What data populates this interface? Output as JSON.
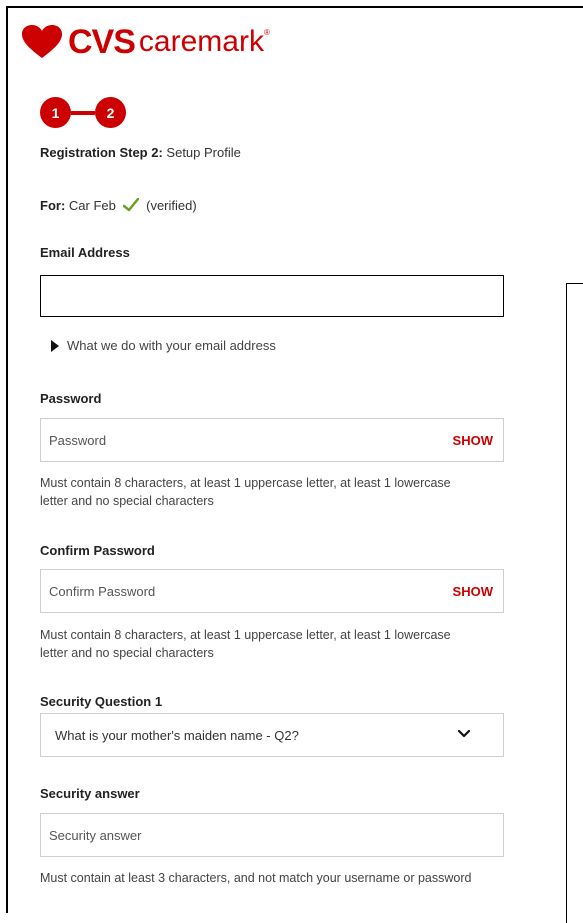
{
  "brand": {
    "primary": "CVS",
    "secondary": "caremark",
    "registered": "®",
    "color": "#cc0000"
  },
  "stepper": {
    "step1": "1",
    "step2": "2"
  },
  "registration": {
    "prefix": "Registration Step 2:",
    "text": "Setup Profile"
  },
  "for": {
    "label": "For:",
    "name": "Car Feb",
    "status": "(verified)"
  },
  "email": {
    "label": "Email Address",
    "value": "",
    "disclosure": "What we do with your email address"
  },
  "password": {
    "label": "Password",
    "placeholder": "Password",
    "show": "SHOW",
    "help": "Must contain 8 characters, at least 1 uppercase letter, at least 1 lowercase letter and no special characters"
  },
  "confirm_password": {
    "label": "Confirm Password",
    "placeholder": "Confirm Password",
    "show": "SHOW",
    "help": "Must contain 8 characters, at least 1 uppercase letter, at least 1 lowercase letter and no special characters"
  },
  "security_question": {
    "label": "Security Question 1",
    "selected": "What is your mother's maiden name - Q2?"
  },
  "security_answer": {
    "label": "Security answer",
    "placeholder": "Security answer",
    "help": "Must contain at least 3 characters, and not match your username or password"
  },
  "icons": {
    "heart": "heart-icon",
    "check": "checkmark-icon",
    "chevron": "chevron-down-icon",
    "disclosure": "triangle-right-icon"
  }
}
